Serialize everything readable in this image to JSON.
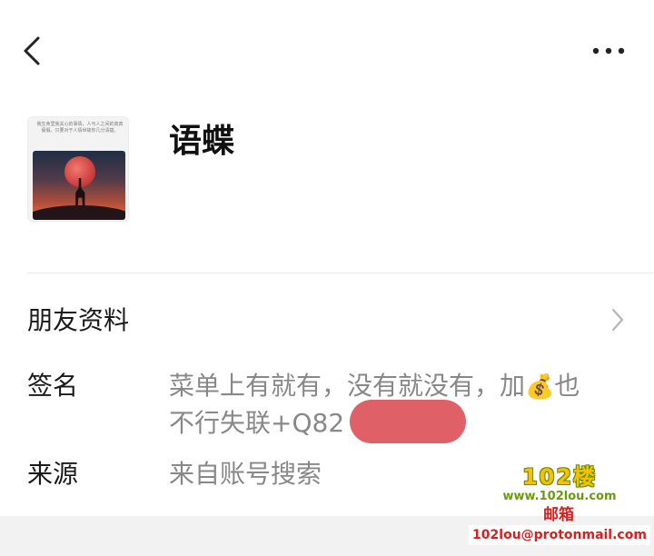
{
  "header": {
    "back_icon": "chevron-left-icon",
    "more_icon": "more-dots-icon"
  },
  "profile": {
    "name": "语蝶",
    "avatar_caption": "我生命里我关心的事情，人与人之间的真真假假。只要对于人情世故你几分清楚。"
  },
  "rows": {
    "friend_info": {
      "label": "朋友资料",
      "icon": "chevron-right-icon"
    },
    "signature": {
      "label": "签名",
      "line1": "菜单上有就有，没有就没有，加",
      "emoji": "💰",
      "line1_end": "也",
      "line2": "不行失联+Q82"
    },
    "source": {
      "label": "来源",
      "value": "来自账号搜索"
    }
  },
  "watermark": {
    "logo": "102楼",
    "url": "www.102lou.com",
    "mail_label": "邮箱",
    "mail": "102lou@protonmail.com"
  },
  "colors": {
    "redaction": "#e06068",
    "label_text": "#1a1a1a",
    "value_text": "#888888"
  }
}
